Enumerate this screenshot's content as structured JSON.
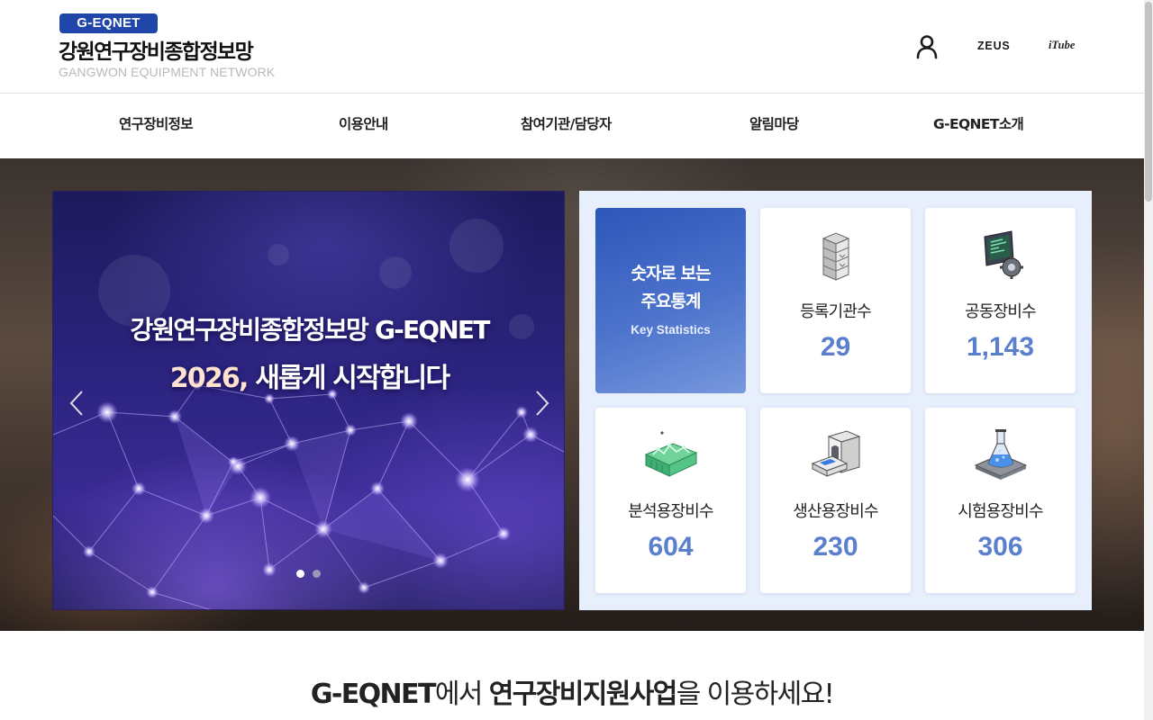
{
  "header": {
    "badge": "G-EQNET",
    "title": "강원연구장비종합정보망",
    "subtitle": "GANGWON EQUIPMENT NETWORK",
    "utils": [
      {
        "name": "user-icon",
        "label": ""
      },
      {
        "name": "zeus-link",
        "label": "ZEUS"
      },
      {
        "name": "itube-link",
        "label": "iTube"
      }
    ]
  },
  "gnb": {
    "items": [
      {
        "label": "연구장비정보"
      },
      {
        "label": "이용안내"
      },
      {
        "label": "참여기관/담당자"
      },
      {
        "label": "알림마당"
      },
      {
        "label": "G-EQNET소개"
      }
    ]
  },
  "slider": {
    "title": "강원연구장비종합정보망 G-EQNET",
    "subtitle_year": "2026,",
    "subtitle_rest": " 새롭게 시작합니다",
    "slide_count": 2,
    "active_slide": 1,
    "prev_icon": "chevron-left",
    "next_icon": "chevron-right"
  },
  "stats": {
    "heading_line1": "숫자로 보는",
    "heading_line2": "주요통계",
    "heading_en": "Key Statistics",
    "items": [
      {
        "label": "등록기관수",
        "value": "29",
        "icon": "building-icon"
      },
      {
        "label": "공동장비수",
        "value": "1,143",
        "icon": "monitor-gear-icon"
      },
      {
        "label": "분석용장비수",
        "value": "604",
        "icon": "analysis-equipment-icon"
      },
      {
        "label": "생산용장비수",
        "value": "230",
        "icon": "production-machine-icon"
      },
      {
        "label": "시험용장비수",
        "value": "306",
        "icon": "flask-icon"
      }
    ]
  },
  "bottom": {
    "part1": "G-EQNET",
    "part2": "에서 ",
    "part3": "연구장비지원사업",
    "part4": "을 이용하세요!"
  },
  "colors": {
    "brand": "#1f46a8",
    "stat_number": "#5a7fcc",
    "stats_bg": "#e7eefc"
  }
}
